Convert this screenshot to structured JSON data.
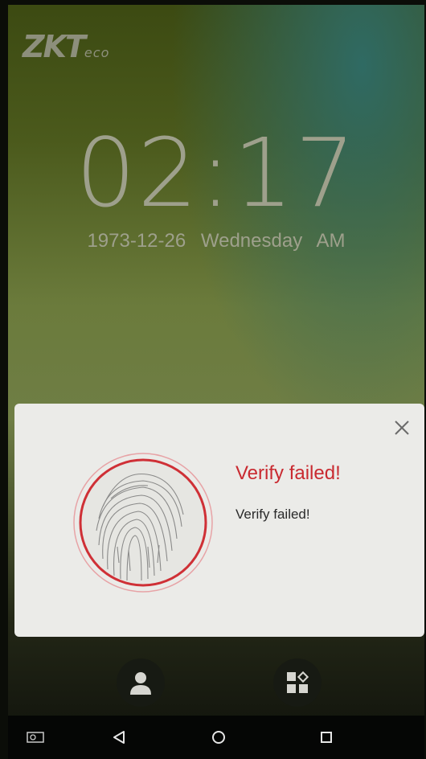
{
  "brand": {
    "logo_main": "ZKT",
    "logo_sub": "eco"
  },
  "clock": {
    "time": "02:17",
    "date": "1973-12-26",
    "weekday": "Wednesday",
    "ampm": "AM"
  },
  "dialog": {
    "title": "Verify failed!",
    "message": "Verify failed!"
  },
  "colors": {
    "error": "#c92a30",
    "dialog_bg": "#ebebe8"
  },
  "actions": [
    {
      "icon": "user-icon"
    },
    {
      "icon": "apps-menu-icon"
    }
  ],
  "navbar": {
    "icons": [
      "screenshot-icon",
      "back-icon",
      "home-icon",
      "recents-icon"
    ]
  }
}
